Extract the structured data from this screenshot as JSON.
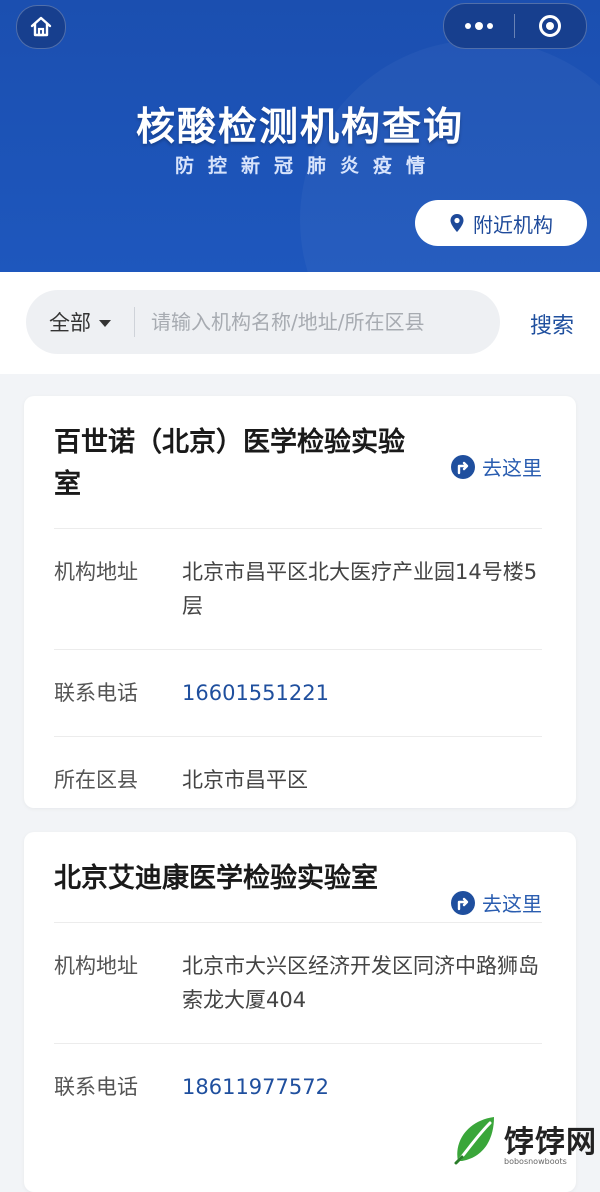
{
  "header": {
    "title": "核酸检测机构查询",
    "subtitle": "防控新冠肺炎疫情",
    "nearby_label": "附近机构"
  },
  "search": {
    "scope": "全部",
    "placeholder": "请输入机构名称/地址/所在区县",
    "button": "搜索"
  },
  "labels": {
    "goto": "去这里",
    "address": "机构地址",
    "phone": "联系电话",
    "district": "所在区县"
  },
  "institutions": [
    {
      "name": "百世诺（北京）医学检验实验室",
      "address": "北京市昌平区北大医疗产业园14号楼5层",
      "phone": "16601551221",
      "district": "北京市昌平区"
    },
    {
      "name": "北京艾迪康医学检验实验室",
      "address": "北京市大兴区经济开发区同济中路狮岛索龙大厦404",
      "phone": "18611977572"
    }
  ],
  "watermark": {
    "brand": "饽饽网",
    "domain": "bobosnowboots"
  },
  "colors": {
    "header_blue": "#1e57bd",
    "link_blue": "#1f4f9e",
    "page_bg": "#f2f4f7"
  }
}
